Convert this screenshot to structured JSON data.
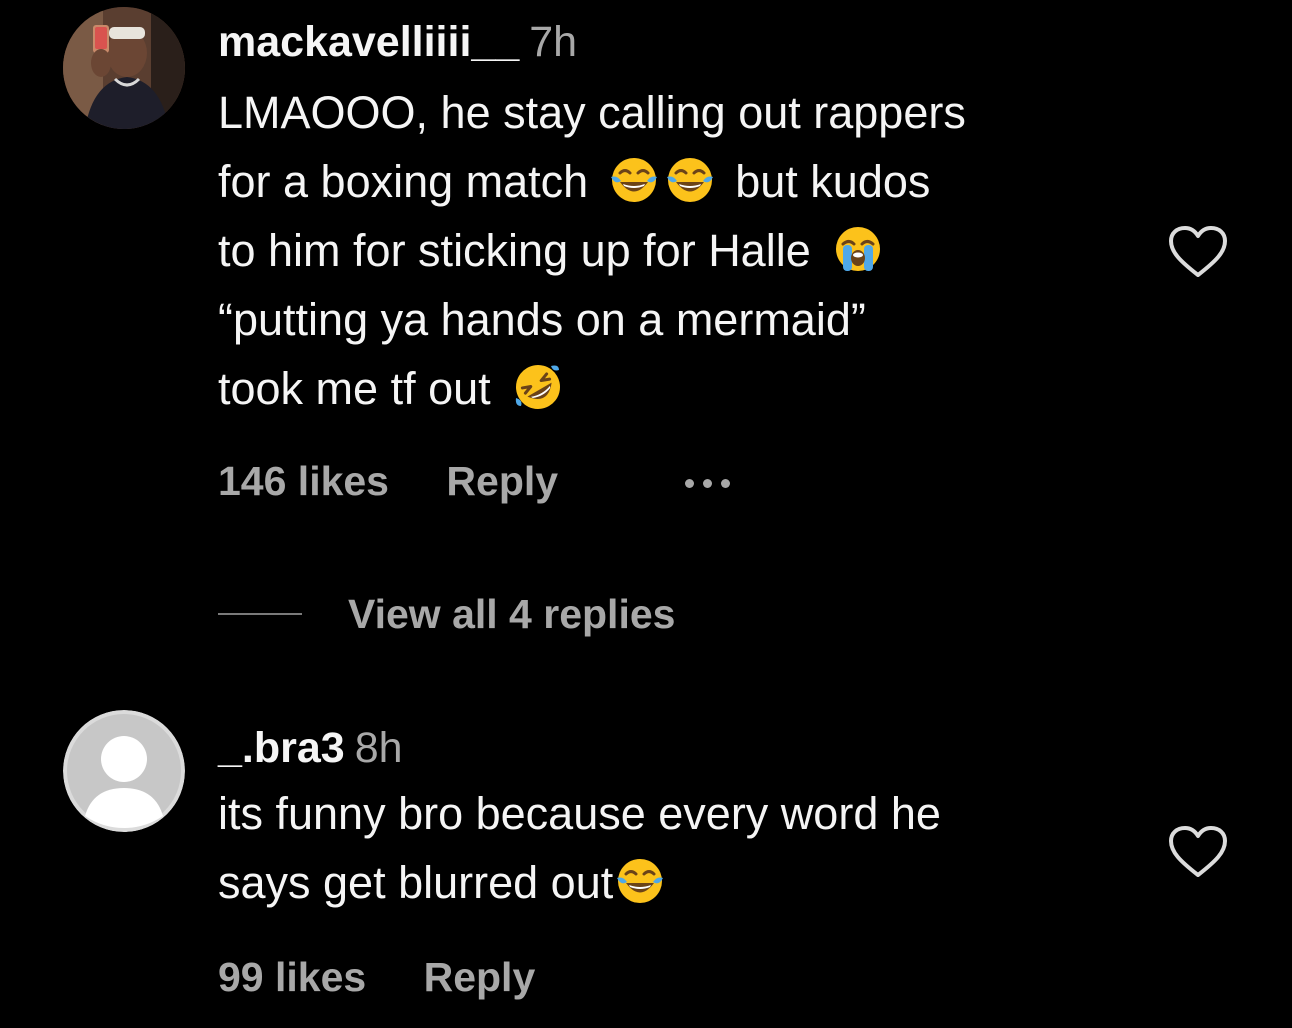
{
  "comments": [
    {
      "username": "mackavelliiii__",
      "time": "7h",
      "lines": [
        "LMAOOO, he stay calling out rappers",
        "for a boxing match",
        "but kudos",
        "to him for sticking up for Halle",
        "“putting ya hands on a mermaid”",
        "took me tf out"
      ],
      "likes": "146 likes",
      "reply_label": "Reply",
      "view_replies": "View all 4 replies"
    },
    {
      "username": "_.bra3",
      "time": "8h",
      "lines": [
        "its funny bro because every word he",
        "says get blurred out"
      ],
      "likes": "99 likes",
      "reply_label": "Reply"
    }
  ],
  "icons": {
    "like": "heart-outline-icon",
    "more": "more-options-icon",
    "emoji_joy": "face-with-tears-of-joy",
    "emoji_sob": "loudly-crying-face",
    "emoji_rofl": "rolling-on-the-floor-laughing",
    "default_avatar": "default-avatar-icon"
  },
  "colors": {
    "background": "#000000",
    "primary_text": "#f5f5f5",
    "secondary_text": "#a8a8a8",
    "emoji_yellow": "#fcc21b",
    "tear_blue": "#4fa8e8"
  }
}
